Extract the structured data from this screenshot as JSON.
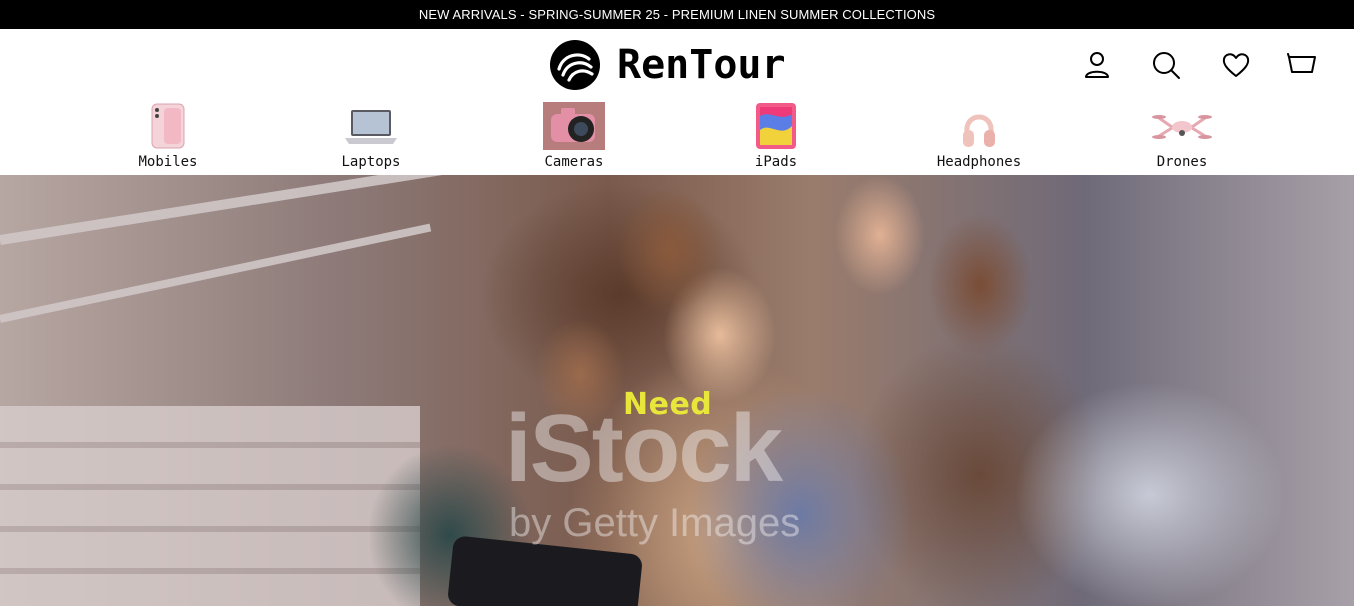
{
  "announcement": {
    "text": "NEW ARRIVALS - SPRING-SUMMER 25 - PREMIUM LINEN SUMMER COLLECTIONS"
  },
  "brand": {
    "name": "RenTour"
  },
  "header_icons": [
    "user-icon",
    "search-icon",
    "heart-icon",
    "cart-icon"
  ],
  "categories": [
    {
      "label": "Mobiles",
      "icon": "mobile-phone-icon",
      "color": "#f2b8c3"
    },
    {
      "label": "Laptops",
      "icon": "laptop-icon",
      "color": "#c9c9cf"
    },
    {
      "label": "Cameras",
      "icon": "camera-icon",
      "color": "#e38fa6"
    },
    {
      "label": "iPads",
      "icon": "tablet-icon",
      "color": "#f25a88"
    },
    {
      "label": "Headphones",
      "icon": "headphones-icon",
      "color": "#f0c2bc"
    },
    {
      "label": "Drones",
      "icon": "drone-icon",
      "color": "#f2c6cc"
    }
  ],
  "hero": {
    "headline": "Need",
    "headline_color": "#e8e63a",
    "watermark": {
      "brand": "iStock",
      "sub": "by Getty Images"
    }
  },
  "colors": {
    "announcement_bg": "#000000",
    "header_bg": "#ffffff"
  }
}
